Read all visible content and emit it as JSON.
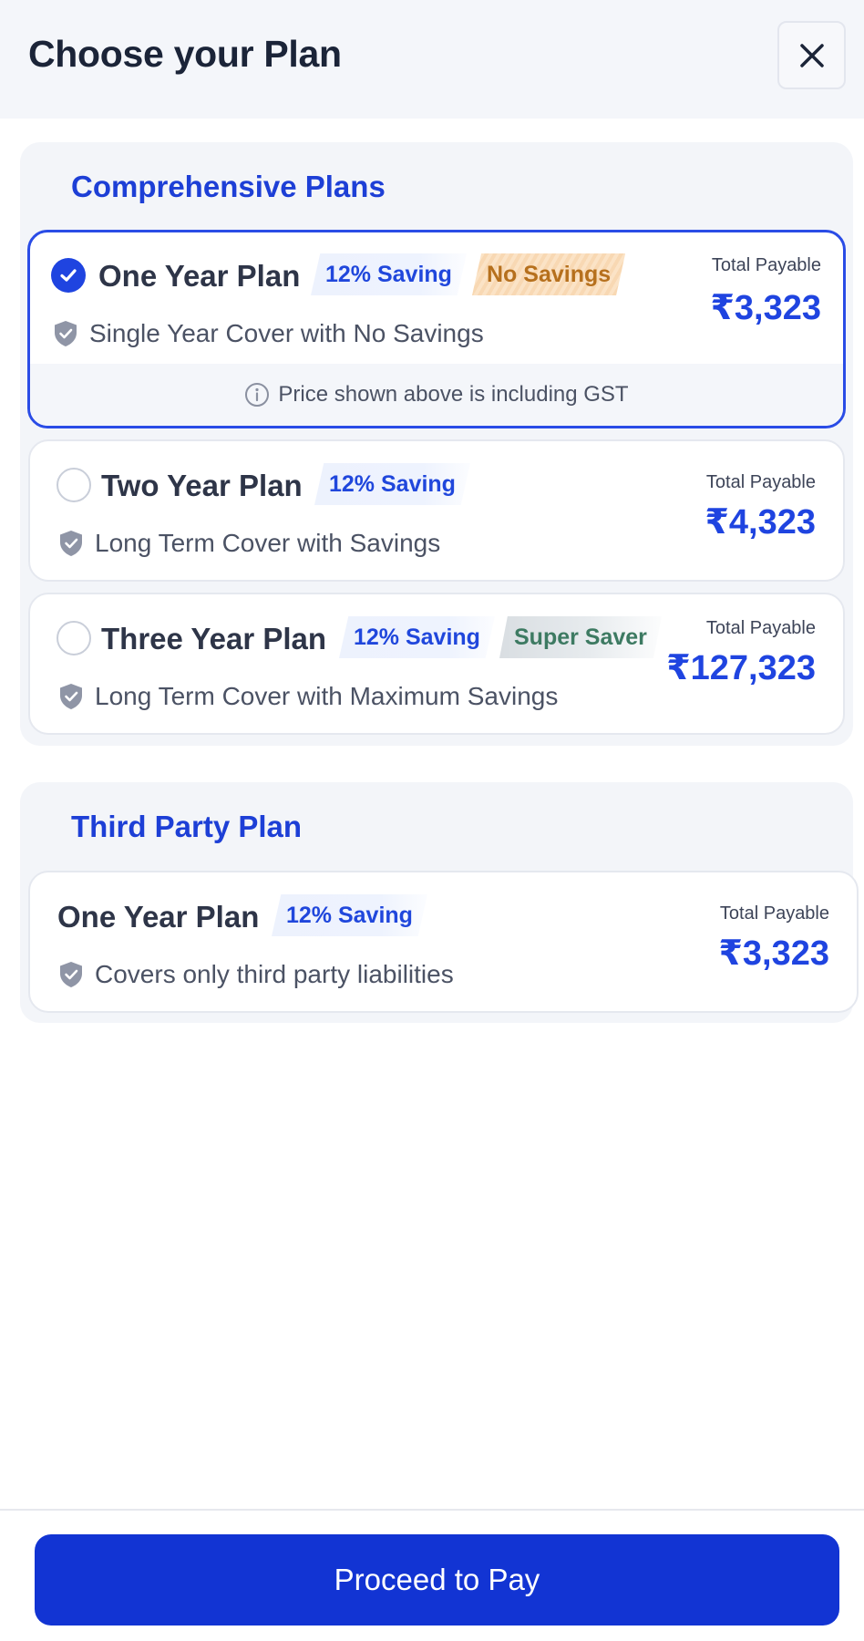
{
  "header": {
    "title": "Choose your Plan",
    "close_icon": "close-icon"
  },
  "comprehensive": {
    "title": "Comprehensive Plans",
    "plans": [
      {
        "name": "One Year Plan",
        "badges": [
          "12% Saving",
          "No Savings"
        ],
        "description": "Single Year Cover with No Savings",
        "payable_label": "Total Payable",
        "price": "₹3,323",
        "selected": true,
        "note": "Price shown above is including GST"
      },
      {
        "name": "Two Year Plan",
        "badges": [
          "12% Saving"
        ],
        "description": "Long Term Cover with Savings",
        "payable_label": "Total Payable",
        "price": "₹4,323",
        "selected": false
      },
      {
        "name": "Three Year Plan",
        "badges": [
          "12% Saving",
          "Super Saver"
        ],
        "description": "Long Term Cover with Maximum Savings",
        "payable_label": "Total Payable",
        "price": "₹127,323",
        "selected": false
      }
    ]
  },
  "third_party": {
    "title": "Third Party Plan",
    "plans": [
      {
        "name": "One Year Plan",
        "badges": [
          "12% Saving"
        ],
        "description": "Covers only third party liabilities",
        "payable_label": "Total Payable",
        "price": "₹3,323"
      }
    ]
  },
  "footer": {
    "button_label": "Proceed to Pay"
  },
  "colors": {
    "accent": "#1f44e0",
    "button": "#1234d3",
    "no_savings_text": "#b6701d",
    "super_saver_text": "#3d7a62"
  }
}
